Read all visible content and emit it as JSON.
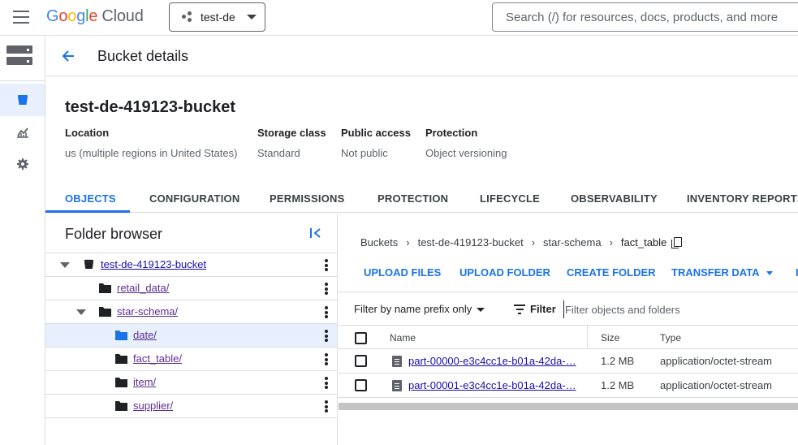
{
  "topbar": {
    "logo_parts": [
      "G",
      "o",
      "o",
      "g",
      "l",
      "e"
    ],
    "logo_product": "Cloud",
    "project": "test-de",
    "search_placeholder": "Search (/) for resources, docs, products, and more"
  },
  "header": {
    "title": "Bucket details"
  },
  "bucket": {
    "name": "test-de-419123-bucket",
    "meta": [
      {
        "key": "Location",
        "value": "us (multiple regions in United States)"
      },
      {
        "key": "Storage class",
        "value": "Standard"
      },
      {
        "key": "Public access",
        "value": "Not public"
      },
      {
        "key": "Protection",
        "value": "Object versioning"
      }
    ]
  },
  "tabs": [
    {
      "label": "OBJECTS",
      "active": true
    },
    {
      "label": "CONFIGURATION"
    },
    {
      "label": "PERMISSIONS"
    },
    {
      "label": "PROTECTION"
    },
    {
      "label": "LIFECYCLE"
    },
    {
      "label": "OBSERVABILITY"
    },
    {
      "label": "INVENTORY REPORTS"
    }
  ],
  "folder_browser": {
    "title": "Folder browser",
    "items": [
      {
        "label": "test-de-419123-bucket",
        "type": "bucket",
        "expanded": true
      },
      {
        "label": "retail_data/",
        "type": "folder"
      },
      {
        "label": "star-schema/",
        "type": "folder",
        "expanded": true
      },
      {
        "label": "date/",
        "type": "folder",
        "selected": true
      },
      {
        "label": "fact_table/",
        "type": "folder"
      },
      {
        "label": "item/",
        "type": "folder"
      },
      {
        "label": "supplier/",
        "type": "folder"
      }
    ]
  },
  "breadcrumb": [
    "Buckets",
    "test-de-419123-bucket",
    "star-schema",
    "fact_table"
  ],
  "actions": {
    "upload_files": "UPLOAD FILES",
    "upload_folder": "UPLOAD FOLDER",
    "create_folder": "CREATE FOLDER",
    "transfer_data": "TRANSFER DATA",
    "overflow_fragment": "I"
  },
  "filter": {
    "prefix_mode": "Filter by name prefix only",
    "label": "Filter",
    "placeholder": "Filter objects and folders"
  },
  "table": {
    "columns": [
      "Name",
      "Size",
      "Type"
    ],
    "rows": [
      {
        "name": "part-00000-e3c4cc1e-b01a-42da-…",
        "size": "1.2 MB",
        "type": "application/octet-stream"
      },
      {
        "name": "part-00001-e3c4cc1e-b01a-42da-…",
        "size": "1.2 MB",
        "type": "application/octet-stream"
      }
    ]
  },
  "colors": {
    "accent": "#1a73e8",
    "selected_bg": "#e8f0fe",
    "folder_link": "#5c2d91",
    "border": "#dadce0"
  }
}
